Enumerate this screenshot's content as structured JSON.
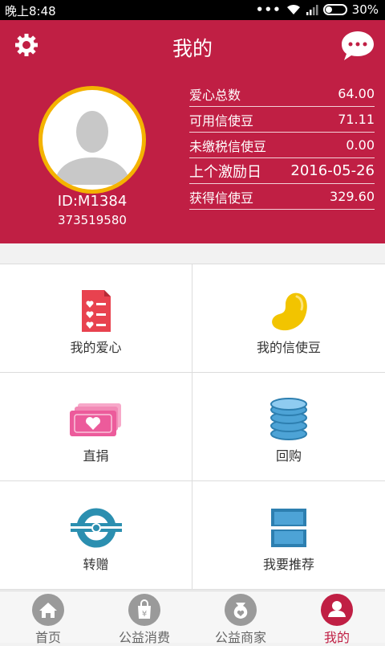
{
  "status_bar": {
    "time": "晚上8:48",
    "signal_dots": "•••",
    "battery": "30%"
  },
  "header": {
    "title": "我的"
  },
  "profile": {
    "id": "ID:M1384",
    "phone": "373519580"
  },
  "stats": [
    {
      "label": "爱心总数",
      "value": "64.00"
    },
    {
      "label": "可用信使豆",
      "value": "71.11"
    },
    {
      "label": "未缴税信使豆",
      "value": "0.00"
    },
    {
      "label": "上个激励日",
      "value": "2016-05-26"
    },
    {
      "label": "获得信使豆",
      "value": "329.60"
    }
  ],
  "grid": [
    {
      "label": "我的爱心",
      "icon": "heart-document-icon"
    },
    {
      "label": "我的信使豆",
      "icon": "bean-icon"
    },
    {
      "label": "直捐",
      "icon": "money-heart-icon"
    },
    {
      "label": "回购",
      "icon": "coin-stack-icon"
    },
    {
      "label": "转赠",
      "icon": "transfer-icon"
    },
    {
      "label": "我要推荐",
      "icon": "scan-icon"
    }
  ],
  "nav": [
    {
      "label": "首页",
      "icon": "home-icon"
    },
    {
      "label": "公益消费",
      "icon": "shopping-bag-icon",
      "symbol": "¥"
    },
    {
      "label": "公益商家",
      "icon": "merchant-bag-icon"
    },
    {
      "label": "我的",
      "icon": "user-icon",
      "active": true
    }
  ],
  "colors": {
    "brand": "#c01f44",
    "avatar_ring": "#f4b300",
    "bean": "#f2c400",
    "coin": "#4da3d6",
    "transfer": "#2b8fb0"
  }
}
